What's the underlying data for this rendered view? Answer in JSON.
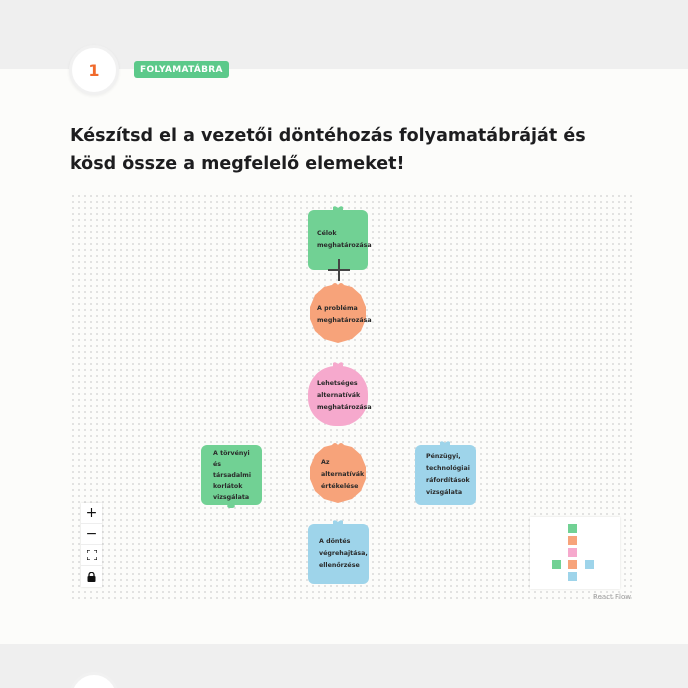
{
  "step": {
    "number": "1",
    "tag": "FOLYAMATÁBRA"
  },
  "title": "Készítsd el a vezetői döntéhozás folyamatábráját és kösd össze a megfelelő elemeket!",
  "colors": {
    "green": "#71d194",
    "orange": "#f7a37a",
    "pink": "#f6a9cd",
    "blue": "#9ed4ea",
    "accent": "#f06a2c",
    "tag": "#5cc98a"
  },
  "nodes": [
    {
      "id": "celok",
      "lines": [
        "Célok",
        "meghatározása"
      ],
      "color": "green",
      "shape": "rect"
    },
    {
      "id": "problema",
      "lines": [
        "A probléma",
        "meghatározása"
      ],
      "color": "orange",
      "shape": "poly"
    },
    {
      "id": "lehetseges",
      "lines": [
        "Lehetséges",
        "alternatívák",
        "meghatározása"
      ],
      "color": "pink",
      "shape": "blob"
    },
    {
      "id": "alternativak",
      "lines": [
        "Az",
        "alternatívák",
        "értékelése"
      ],
      "color": "orange",
      "shape": "poly"
    },
    {
      "id": "torvenyi",
      "lines": [
        "A törvényi",
        "és",
        "társadalmi",
        "korlátok",
        "vizsgálata"
      ],
      "color": "green",
      "shape": "rect"
    },
    {
      "id": "penzugyi",
      "lines": [
        "Pénzügyi,",
        "technológiai",
        "ráfordítások",
        "vizsgálata"
      ],
      "color": "blue",
      "shape": "rect"
    },
    {
      "id": "dontes",
      "lines": [
        "A döntés",
        "végrehajtása,",
        "ellenőrzése"
      ],
      "color": "blue",
      "shape": "rect"
    }
  ],
  "controls": [
    {
      "name": "zoom-in-button",
      "icon": "plus-icon",
      "glyph": "+"
    },
    {
      "name": "zoom-out-button",
      "icon": "minus-icon",
      "glyph": "−"
    },
    {
      "name": "fit-view-button",
      "icon": "fit-view-icon",
      "glyph": "⛶"
    },
    {
      "name": "lock-button",
      "icon": "lock-icon",
      "glyph": "🔒"
    }
  ],
  "attribution": "React Flow"
}
